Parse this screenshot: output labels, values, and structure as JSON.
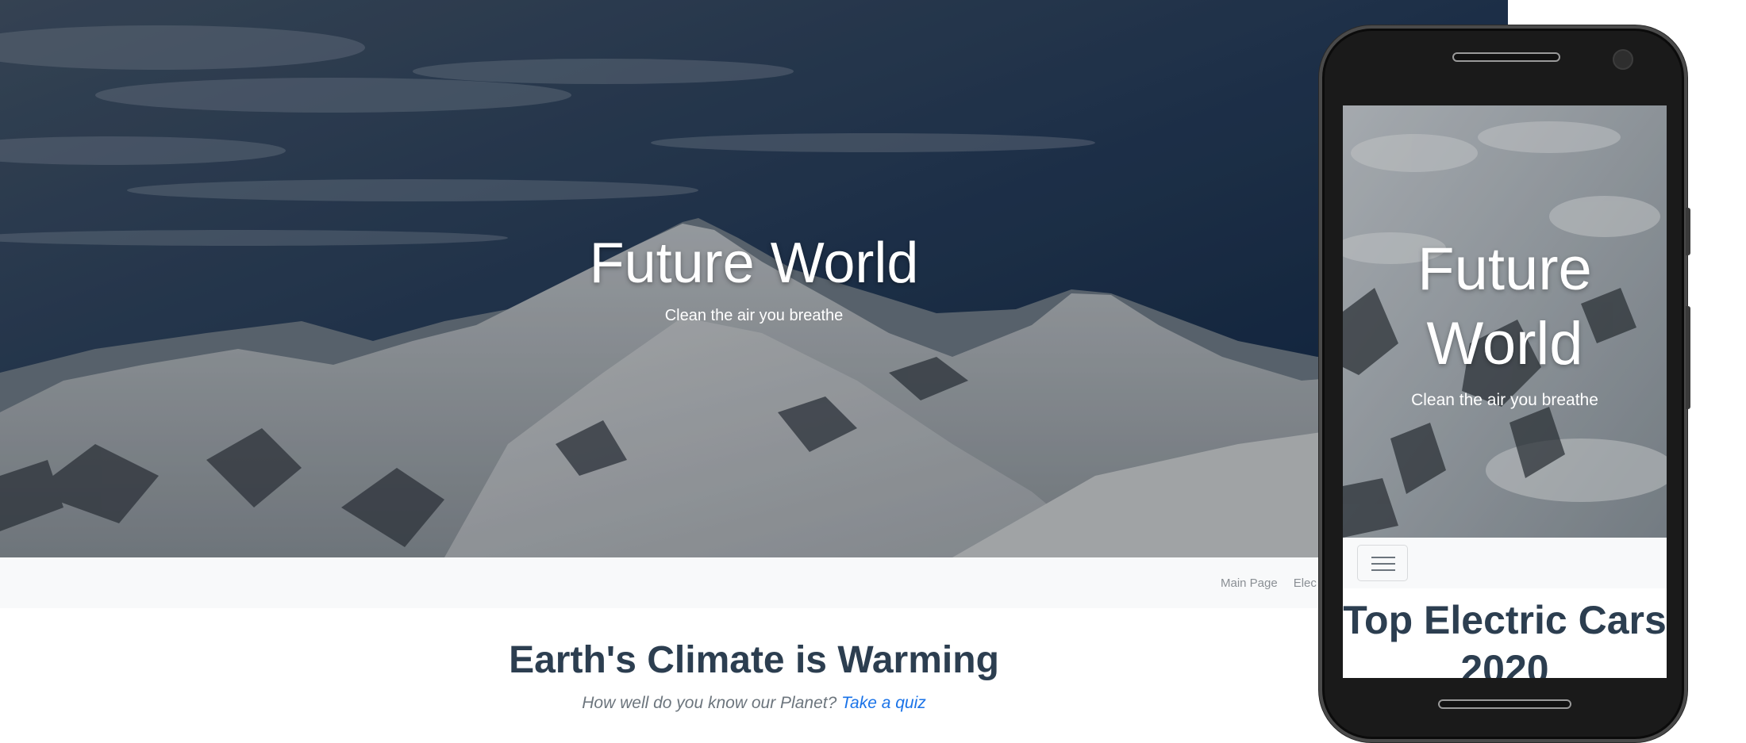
{
  "desktop": {
    "hero": {
      "title": "Future World",
      "subtitle": "Clean the air you breathe"
    },
    "navbar": {
      "links": [
        "Main Page",
        "Elec"
      ]
    },
    "section": {
      "title": "Earth's Climate is Warming",
      "subtitle_prefix": "How well do you know our Planet?",
      "quiz_link": "Take a quiz"
    }
  },
  "mobile": {
    "hero": {
      "title": "Future World",
      "subtitle": "Clean the air you breathe"
    },
    "navbar": {
      "toggler_icon": "hamburger-menu-icon"
    },
    "heading": "Top Electric Cars 2020"
  },
  "colors": {
    "heading": "#2c3e50",
    "link": "#1a73e8",
    "navbar_bg": "#f8f9fa",
    "muted_text": "#6c757d",
    "phone_body": "#1a1a1a"
  }
}
